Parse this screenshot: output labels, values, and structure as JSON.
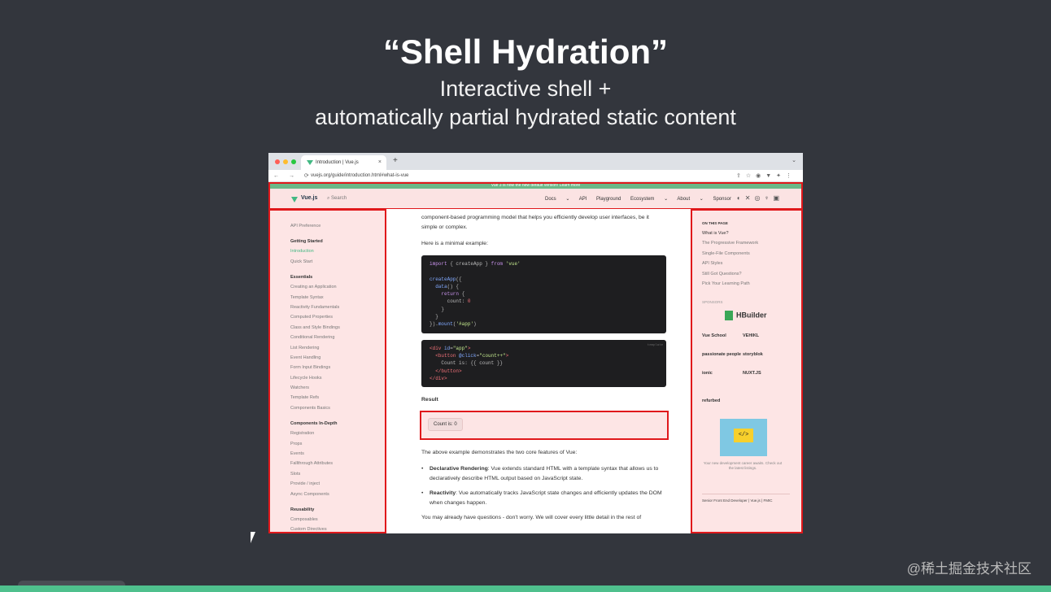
{
  "slide": {
    "title": "“Shell Hydration”",
    "subtitle_line1": "Interactive shell +",
    "subtitle_line2": "automatically partial hydrated static content"
  },
  "browser": {
    "tab_title": "Introduction | Vue.js",
    "url": "vuejs.org/guide/introduction.html#what-is-vue"
  },
  "site": {
    "banner": "Vue 3 is now the new default version! Learn more",
    "brand": "Vue.js",
    "search_placeholder": "Search",
    "nav_links": "Docs ⌄ API Playground Ecosystem ⌄ About ⌄ Sponsor"
  },
  "sidebar": {
    "top_item": "API Preference",
    "groups": [
      {
        "title": "Getting Started",
        "items": [
          "Introduction",
          "Quick Start"
        ]
      },
      {
        "title": "Essentials",
        "items": [
          "Creating an Application",
          "Template Syntax",
          "Reactivity Fundamentals",
          "Computed Properties",
          "Class and Style Bindings",
          "Conditional Rendering",
          "List Rendering",
          "Event Handling",
          "Form Input Bindings",
          "Lifecycle Hooks",
          "Watchers",
          "Template Refs",
          "Components Basics"
        ]
      },
      {
        "title": "Components In-Depth",
        "items": [
          "Registration",
          "Props",
          "Events",
          "Fallthrough Attributes",
          "Slots",
          "Provide / inject",
          "Async Components"
        ]
      },
      {
        "title": "Reusability",
        "items": [
          "Composables",
          "Custom Directives"
        ]
      }
    ]
  },
  "content": {
    "intro": "component-based programming model that helps you efficiently develop user interfaces, be it simple or complex.",
    "minimal": "Here is a minimal example:",
    "result_label": "Result",
    "count_button": "Count is: 0",
    "features_intro": "The above example demonstrates the two core features of Vue:",
    "feature1_title": "Declarative Rendering",
    "feature1_text": ": Vue extends standard HTML with a template syntax that allows us to declaratively describe HTML output based on JavaScript state.",
    "feature2_title": "Reactivity",
    "feature2_text": ": Vue automatically tracks JavaScript state changes and efficiently updates the DOM when changes happen.",
    "outro": "You may already have questions - don't worry. We will cover every little detail in the rest of"
  },
  "toc": {
    "header": "ON THIS PAGE",
    "items": [
      "What is Vue?",
      "The Progressive Framework",
      "Single-File Components",
      "API Styles",
      "Still Got Questions?",
      "Pick Your Learning Path"
    ],
    "sponsors_header": "SPONSORS",
    "sponsors": [
      "Vue School",
      "VEHIKL",
      "passionate people",
      "storyblok",
      "ionic",
      "NUXT.JS",
      "refurbed",
      ""
    ],
    "hbuilder": "HBuilder",
    "ad_text": "Your new development career awaits. Check out the latest listings.",
    "series": "Senior Front End Developer | Vue.js | FMIC"
  },
  "watermark": "@稀土掘金技术社区"
}
